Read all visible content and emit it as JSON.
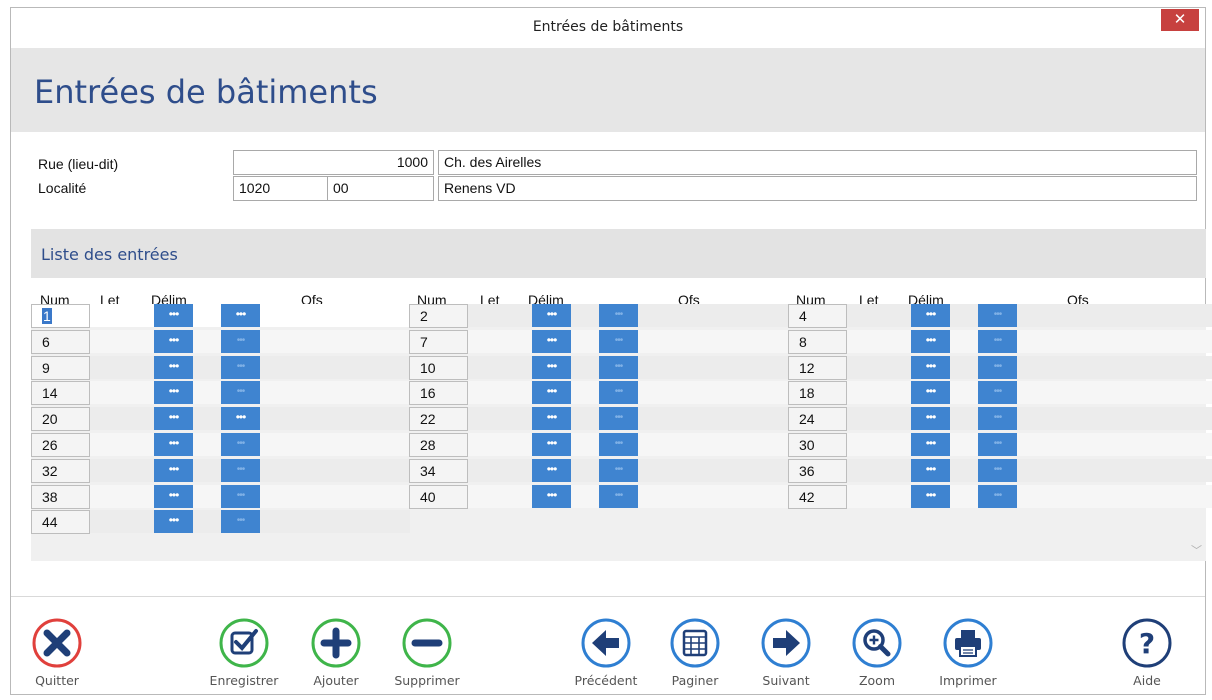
{
  "window": {
    "title": "Entrées de bâtiments",
    "close_label": "✕"
  },
  "header": {
    "title": "Entrées de bâtiments"
  },
  "form": {
    "rue_label": "Rue (lieu-dit)",
    "localite_label": "Localité",
    "rue_number": "1000",
    "rue_name": "Ch. des Airelles",
    "npa": "1020",
    "npa_suffix": "00",
    "localite_name": "Renens VD"
  },
  "list": {
    "title": "Liste des entrées",
    "headers": {
      "num": "Num",
      "let": "Let",
      "delim": "Délim",
      "ofs": "Ofs"
    },
    "button_glyph": "•••",
    "columns": [
      {
        "nums": [
          "1",
          "6",
          "9",
          "14",
          "20",
          "26",
          "32",
          "38",
          "44"
        ]
      },
      {
        "nums": [
          "2",
          "7",
          "10",
          "16",
          "22",
          "28",
          "34",
          "40"
        ]
      },
      {
        "nums": [
          "4",
          "8",
          "12",
          "18",
          "24",
          "30",
          "36",
          "42"
        ]
      }
    ],
    "selected_num": "1"
  },
  "toolbar": {
    "quitter": "Quitter",
    "enregistrer": "Enregistrer",
    "ajouter": "Ajouter",
    "supprimer": "Supprimer",
    "precedent": "Précédent",
    "paginer": "Paginer",
    "suivant": "Suivant",
    "zoom": "Zoom",
    "imprimer": "Imprimer",
    "aide": "Aide"
  },
  "colors": {
    "accent_blue": "#2e4d8b",
    "button_blue": "#3f84d0",
    "red": "#e0403c",
    "green": "#3fb54a",
    "blue_icon": "#2f7fd2",
    "navy_icon": "#1f3f78"
  }
}
